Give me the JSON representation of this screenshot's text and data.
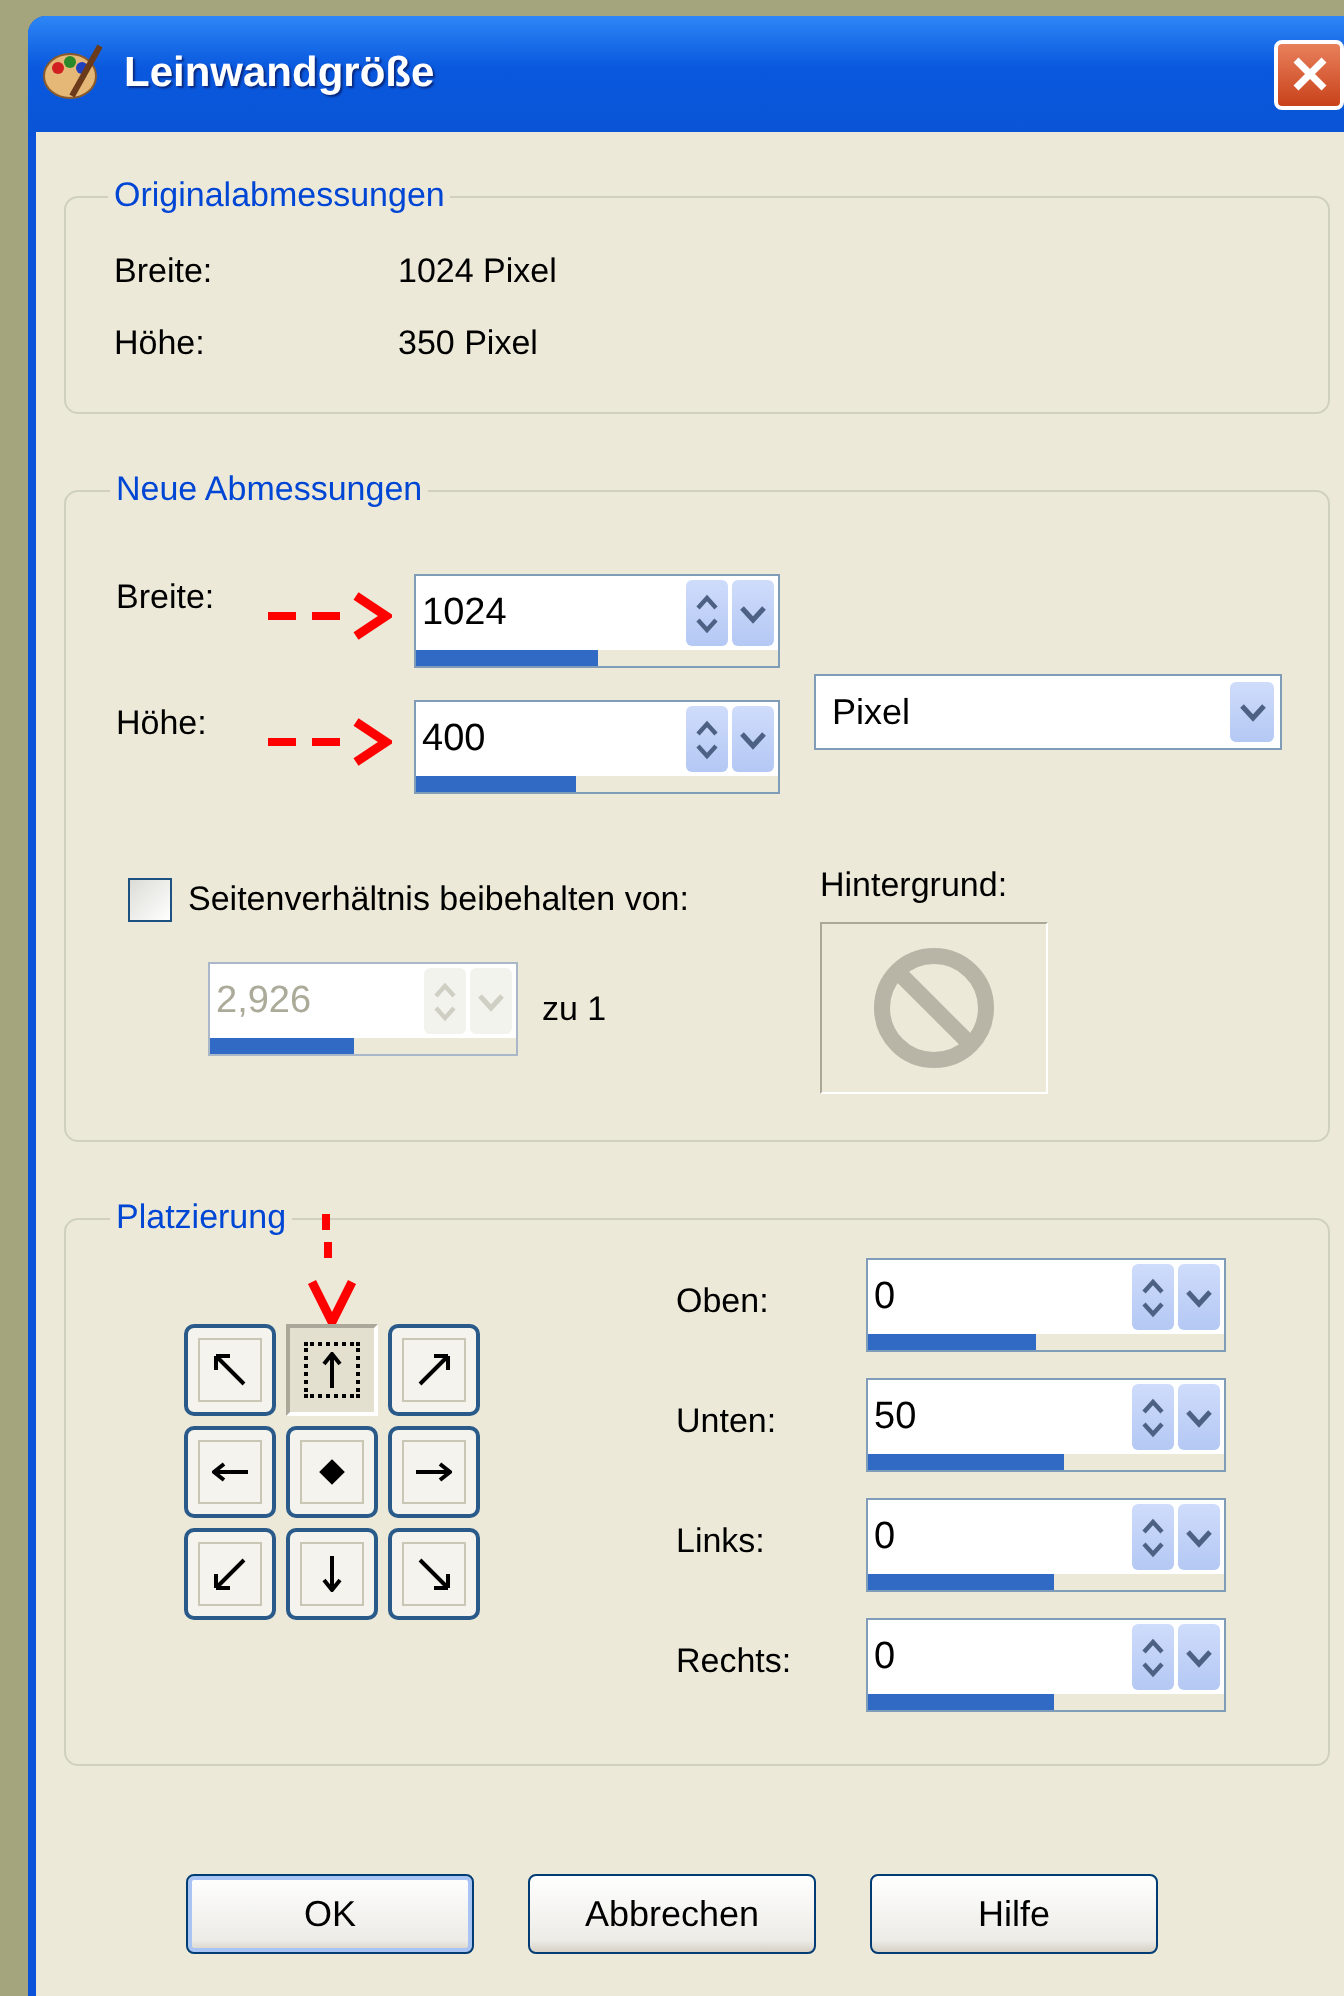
{
  "window": {
    "title": "Leinwandgröße"
  },
  "original_dimensions": {
    "title": "Originalabmessungen",
    "rows": [
      {
        "label": "Breite:",
        "value": "1024 Pixel"
      },
      {
        "label": "Höhe:",
        "value": "350 Pixel"
      }
    ]
  },
  "new_dimensions": {
    "title": "Neue Abmessungen",
    "fields": [
      {
        "label": "Breite:",
        "value": "1024",
        "level": 0.5,
        "annotated": true
      },
      {
        "label": "Höhe:",
        "value": "400",
        "level": 0.44,
        "annotated": true
      }
    ],
    "unit": {
      "value": "Pixel"
    },
    "keep_ratio": {
      "label": "Seitenverhältnis beibehalten von:",
      "checked": false
    },
    "ratio": {
      "value": "2,926",
      "disabled": true,
      "level": 0.47,
      "suffix": "zu 1"
    },
    "background": {
      "label": "Hintergrund:"
    }
  },
  "placement": {
    "title": "Platzierung",
    "annotated": true,
    "anchors": [
      {
        "kind": "nw",
        "selected": false
      },
      {
        "kind": "n",
        "selected": true
      },
      {
        "kind": "ne",
        "selected": false
      },
      {
        "kind": "w",
        "selected": false
      },
      {
        "kind": "center",
        "selected": false
      },
      {
        "kind": "e",
        "selected": false
      },
      {
        "kind": "sw",
        "selected": false
      },
      {
        "kind": "s",
        "selected": false
      },
      {
        "kind": "se",
        "selected": false
      }
    ],
    "fields": [
      {
        "label": "Oben:",
        "value": "0",
        "level": 0.47
      },
      {
        "label": "Unten:",
        "value": "50",
        "level": 0.55
      },
      {
        "label": "Links:",
        "value": "0",
        "level": 0.52
      },
      {
        "label": "Rechts:",
        "value": "0",
        "level": 0.52
      }
    ]
  },
  "buttons": [
    {
      "label": "OK",
      "default": true
    },
    {
      "label": "Abbrechen",
      "default": false
    },
    {
      "label": "Hilfe",
      "default": false
    }
  ]
}
